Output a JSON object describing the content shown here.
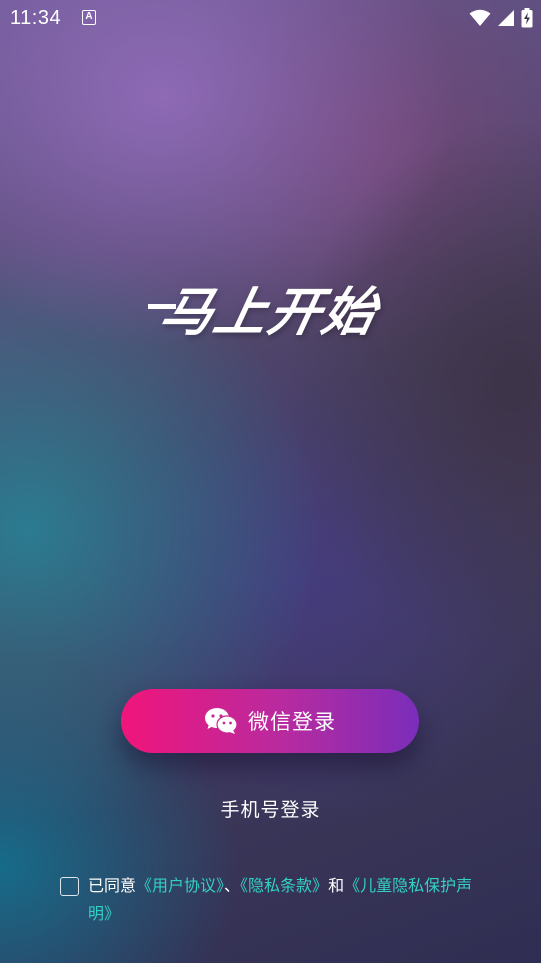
{
  "status_bar": {
    "time": "11:34",
    "left_icon_glyph": "A",
    "icons": [
      "a-notification-icon",
      "wifi-icon",
      "cell-signal-icon",
      "battery-charging-icon"
    ]
  },
  "headline": "马上开始",
  "login": {
    "wechat_label": "微信登录",
    "wechat_icon": "wechat-icon",
    "phone_label": "手机号登录"
  },
  "agreement": {
    "prefix": "已同意",
    "user_agreement": "《用户协议》",
    "sep1": "、",
    "privacy_terms": "《隐私条款》",
    "and": "和",
    "child_privacy": "《儿童隐私保护声明》",
    "checked": false
  },
  "colors": {
    "accent_link": "#33d0c4",
    "button_gradient_start": "#f0157a",
    "button_gradient_end": "#7a2dba",
    "text": "#ffffff"
  }
}
